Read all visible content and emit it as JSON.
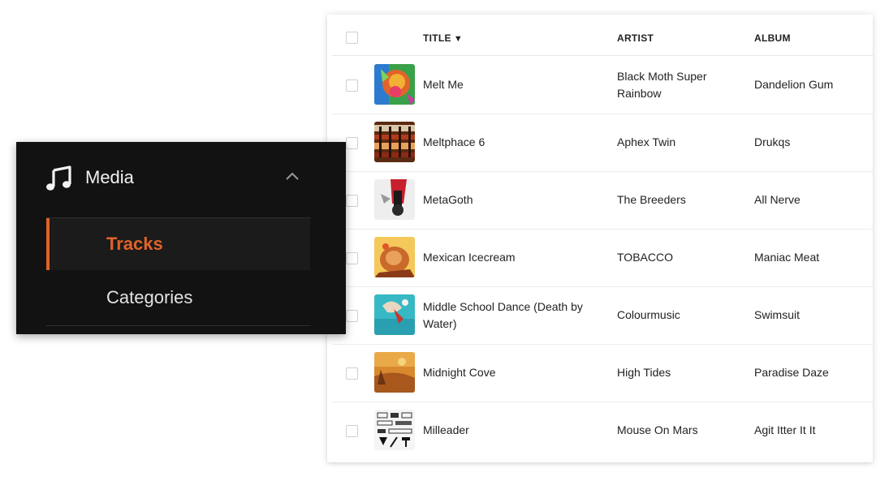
{
  "table": {
    "headers": {
      "title": "TITLE",
      "sort_indicator": "▼",
      "artist": "ARTIST",
      "album": "ALBUM"
    },
    "rows": [
      {
        "title": "Melt Me",
        "artist": "Black Moth Super Rainbow",
        "album": "Dandelion Gum"
      },
      {
        "title": "Meltphace 6",
        "artist": "Aphex Twin",
        "album": "Drukqs"
      },
      {
        "title": "MetaGoth",
        "artist": "The Breeders",
        "album": "All Nerve"
      },
      {
        "title": "Mexican Icecream",
        "artist": "TOBACCO",
        "album": "Maniac Meat"
      },
      {
        "title": "Middle School Dance (Death by Water)",
        "artist": "Colourmusic",
        "album": "Swimsuit"
      },
      {
        "title": "Midnight Cove",
        "artist": "High Tides",
        "album": "Paradise Daze"
      },
      {
        "title": "Milleader",
        "artist": "Mouse On Mars",
        "album": "Agit Itter It It"
      }
    ]
  },
  "menu": {
    "section": {
      "icon": "music-note-icon",
      "title": "Media",
      "toggle_icon": "chevron-up-icon",
      "expanded": true
    },
    "items": [
      {
        "label": "Tracks",
        "active": true
      },
      {
        "label": "Categories",
        "active": false
      }
    ]
  },
  "colors": {
    "accent": "#e0632a",
    "menu_bg": "#121212",
    "active_bg": "#1b1b1b"
  }
}
